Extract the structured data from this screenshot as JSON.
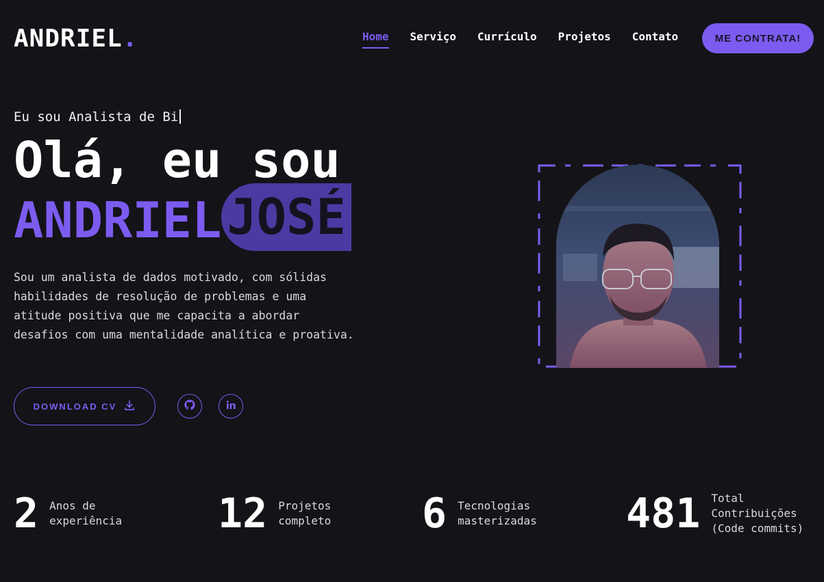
{
  "header": {
    "logo_text": "ANDRIEL",
    "logo_dot": ".",
    "nav": [
      {
        "label": "Home",
        "active": true
      },
      {
        "label": "Serviço",
        "active": false
      },
      {
        "label": "Currículo",
        "active": false
      },
      {
        "label": "Projetos",
        "active": false
      },
      {
        "label": "Contato",
        "active": false
      }
    ],
    "cta_label": "ME CONTRATA!"
  },
  "hero": {
    "typing_text": "Eu sou Analista de Bi",
    "headline": "Olá, eu sou",
    "first_name": "ANDRIEL",
    "last_name": "JOSÉ",
    "intro": "Sou um analista de dados motivado, com sólidas habilidades de resolução de problemas e uma atitude positiva que me capacita a abordar desafios com uma mentalidade analítica e proativa.",
    "download_label": "DOWNLOAD CV",
    "social": [
      "github-icon",
      "linkedin-icon"
    ]
  },
  "stats": [
    {
      "value": "2",
      "label_line1": "Anos de",
      "label_line2": "experiência",
      "label_line3": ""
    },
    {
      "value": "12",
      "label_line1": "Projetos",
      "label_line2": "completo",
      "label_line3": ""
    },
    {
      "value": "6",
      "label_line1": "Tecnologias",
      "label_line2": "masterizadas",
      "label_line3": ""
    },
    {
      "value": "481",
      "label_line1": "Total",
      "label_line2": "Contribuições",
      "label_line3": "(Code commits)"
    }
  ],
  "colors": {
    "background": "#141318",
    "accent": "#7c5cf0",
    "accent_dark": "#4c3aa3",
    "text": "#ffffff"
  }
}
